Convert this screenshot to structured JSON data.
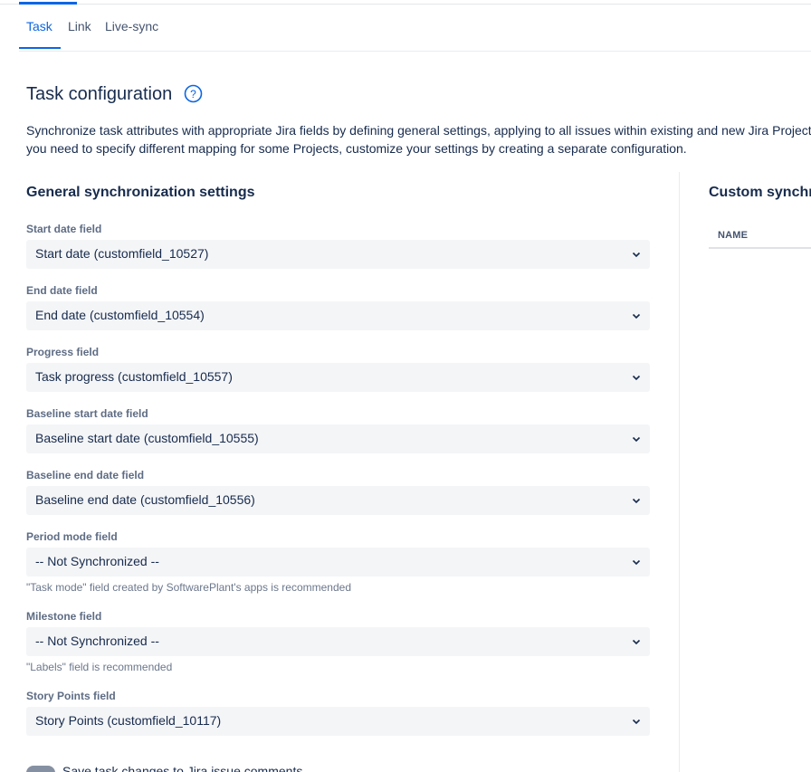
{
  "tabs": [
    {
      "label": "Task"
    },
    {
      "label": "Link"
    },
    {
      "label": "Live-sync"
    }
  ],
  "page": {
    "title": "Task configuration",
    "description_line1": "Synchronize task attributes with appropriate Jira fields by defining general settings, applying to all issues within existing and new Jira Project",
    "description_line2": "you need to specify different mapping for some Projects, customize your settings by creating a separate configuration."
  },
  "general": {
    "title": "General synchronization settings",
    "fields": [
      {
        "label": "Start date field",
        "value": "Start date (customfield_10527)"
      },
      {
        "label": "End date field",
        "value": "End date (customfield_10554)"
      },
      {
        "label": "Progress field",
        "value": "Task progress (customfield_10557)"
      },
      {
        "label": "Baseline start date field",
        "value": "Baseline start date (customfield_10555)"
      },
      {
        "label": "Baseline end date field",
        "value": "Baseline end date (customfield_10556)"
      },
      {
        "label": "Period mode field",
        "value": "-- Not Synchronized --",
        "hint": "\"Task mode\" field created by SoftwarePlant's apps is recommended"
      },
      {
        "label": "Milestone field",
        "value": "-- Not Synchronized --",
        "hint": "\"Labels\" field is recommended"
      },
      {
        "label": "Story Points field",
        "value": "Story Points (customfield_10117)"
      }
    ],
    "toggle_label": "Save task changes to Jira issue comments"
  },
  "custom": {
    "title": "Custom synchro",
    "column_name": "NAME"
  },
  "colors": {
    "accent": "#0c66e4",
    "select_bg": "#f4f5f7"
  },
  "icons": {
    "help": "question-circle-icon",
    "dropdown": "chevron-down-icon"
  }
}
